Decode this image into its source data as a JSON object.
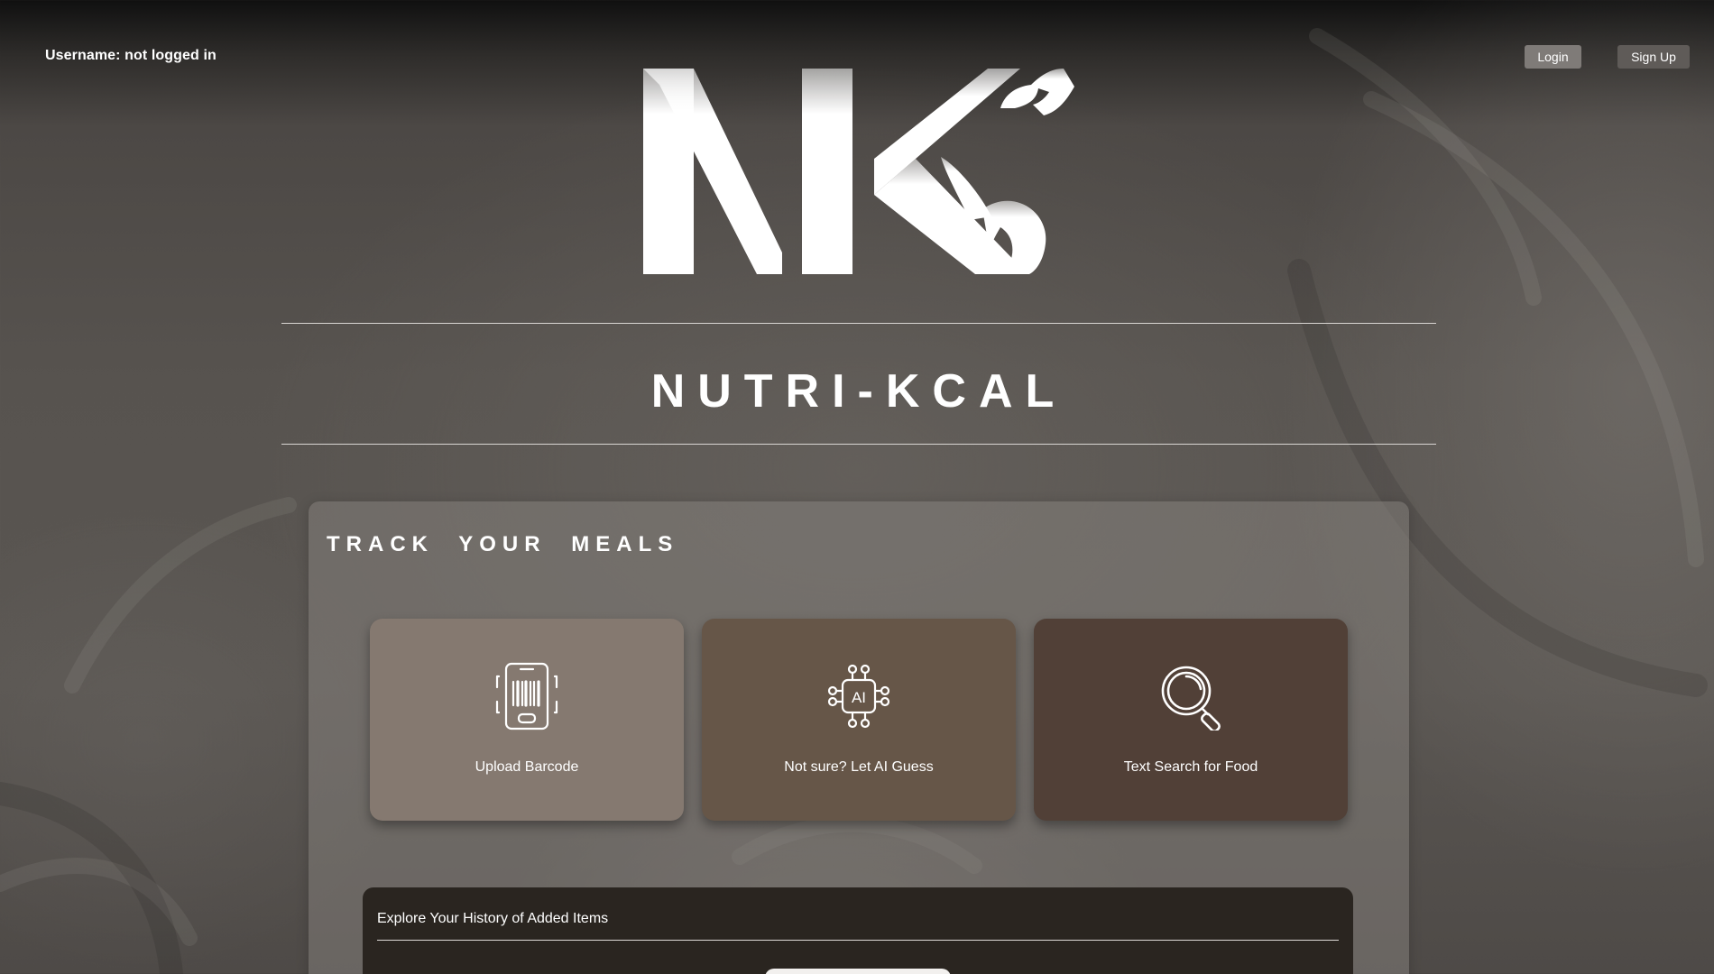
{
  "header": {
    "username_label": "Username: not logged in",
    "login_label": "Login",
    "signup_label": "Sign Up"
  },
  "brand": {
    "title": "NUTRI-KCAL",
    "logo_icon": "nk-logo-icon"
  },
  "track_panel": {
    "title": "TRACK YOUR MEALS",
    "cards": [
      {
        "label": "Upload Barcode",
        "icon": "barcode-phone-icon",
        "color": "#857970"
      },
      {
        "label": "Not sure? Let AI Guess",
        "icon": "ai-chip-icon",
        "color": "#665648"
      },
      {
        "label": "Text Search for Food",
        "icon": "magnifier-icon",
        "color": "#514037"
      }
    ]
  },
  "history": {
    "title": "Explore Your History of Added Items"
  },
  "colors": {
    "login_button": "#7f7b78",
    "signup_button": "#5f5b58",
    "history_panel": "#2a2520"
  }
}
